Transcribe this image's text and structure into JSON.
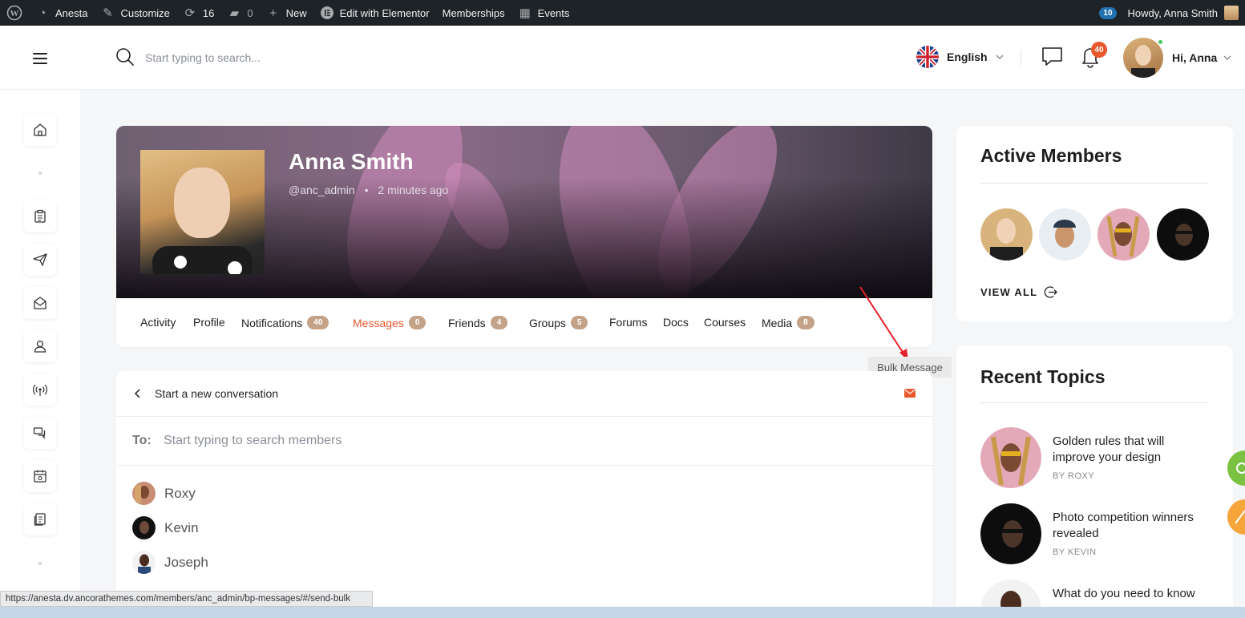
{
  "admin_bar": {
    "site": "Anesta",
    "customize": "Customize",
    "updates": "16",
    "comments": "0",
    "new": "New",
    "elementor": "Edit with Elementor",
    "memberships": "Memberships",
    "events": "Events",
    "notif_count": "10",
    "howdy": "Howdy, Anna Smith"
  },
  "header": {
    "search_placeholder": "Start typing to search...",
    "language": "English",
    "bell_count": "40",
    "greeting": "Hi,  Anna"
  },
  "profile": {
    "name": "Anna Smith",
    "handle": "@anc_admin",
    "last_active": "2 minutes ago",
    "tabs": [
      {
        "label": "Activity"
      },
      {
        "label": "Profile"
      },
      {
        "label": "Notifications",
        "count": "40"
      },
      {
        "label": "Messages",
        "count": "0"
      },
      {
        "label": "Friends",
        "count": "4"
      },
      {
        "label": "Groups",
        "count": "5"
      },
      {
        "label": "Forums"
      },
      {
        "label": "Docs"
      },
      {
        "label": "Courses"
      },
      {
        "label": "Media",
        "count": "8"
      }
    ]
  },
  "tooltip": "Bulk Message",
  "conversation": {
    "title": "Start a new conversation",
    "to_label": "To:",
    "to_placeholder": "Start typing to search members",
    "members": [
      "Roxy",
      "Kevin",
      "Joseph"
    ]
  },
  "active_members": {
    "title": "Active Members",
    "view_all": "VIEW ALL"
  },
  "recent_topics": {
    "title": "Recent Topics",
    "items": [
      {
        "title": "Golden rules that will improve your design",
        "by": "BY ROXY"
      },
      {
        "title": "Photo competition winners revealed",
        "by": "BY KEVIN"
      },
      {
        "title": "What do you need to know",
        "by": ""
      }
    ]
  },
  "status_url": "https://anesta.dv.ancorathemes.com/members/anc_admin/bp-messages/#/send-bulk",
  "colors": {
    "accent": "#e9572e",
    "badge": "#c4a287",
    "adminbar": "#1d2327"
  }
}
